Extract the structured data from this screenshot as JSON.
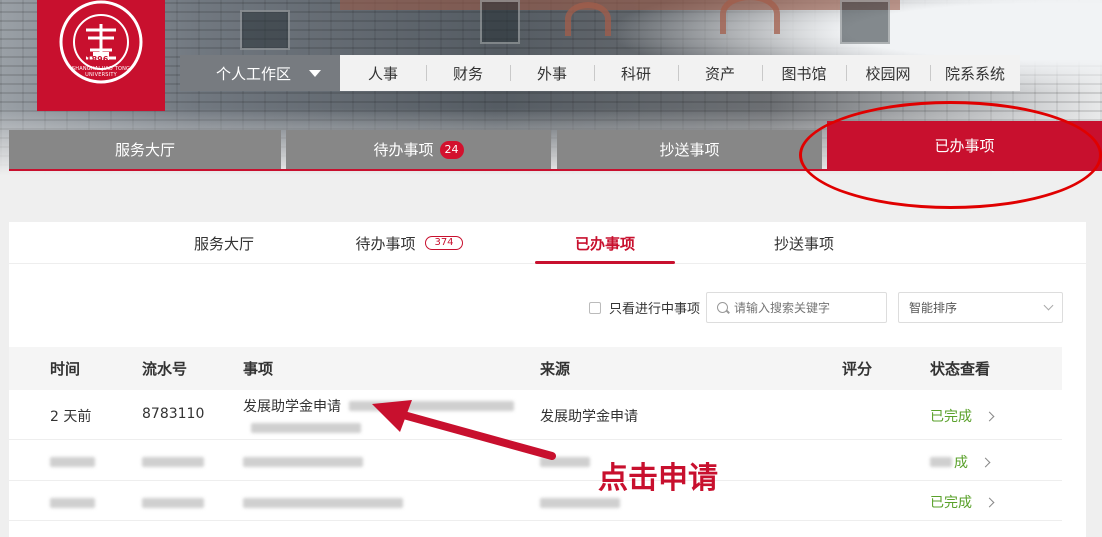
{
  "header": {
    "logo_text": "SHANGHAI JIAO TONG UNIVERSITY",
    "logo_year": "1896",
    "workspace_label": "个人工作区",
    "topnav": [
      "人事",
      "财务",
      "外事",
      "科研",
      "资产",
      "图书馆",
      "校园网",
      "院系系统"
    ]
  },
  "bigtabs": {
    "service": "服务大厅",
    "todo": "待办事项",
    "todo_count": "24",
    "cc": "抄送事项",
    "done": "已办事项"
  },
  "subtabs": {
    "service": "服务大厅",
    "todo": "待办事项",
    "todo_count": "374",
    "done": "已办事项",
    "cc": "抄送事项"
  },
  "filters": {
    "only_ongoing": "只看进行中事项",
    "search_placeholder": "请输入搜索关键字",
    "sort": "智能排序"
  },
  "table": {
    "headers": [
      "时间",
      "流水号",
      "事项",
      "来源",
      "评分",
      "状态查看"
    ],
    "rows": [
      {
        "time": "2 天前",
        "serial": "8783110",
        "item": "发展助学金申请",
        "source": "发展助学金申请",
        "score": "",
        "status": "已完成"
      },
      {
        "time": "",
        "serial": "",
        "item": "",
        "source": "",
        "score": "",
        "status": "成"
      },
      {
        "time": "",
        "serial": "",
        "item": "",
        "source": "",
        "score": "",
        "status": "已完成"
      }
    ]
  },
  "annotation": {
    "callout": "点击申请",
    "color": "#c8102e"
  },
  "colors": {
    "brand": "#c8102e",
    "tab_gray": "#878787",
    "done_green": "#5aa12b"
  }
}
